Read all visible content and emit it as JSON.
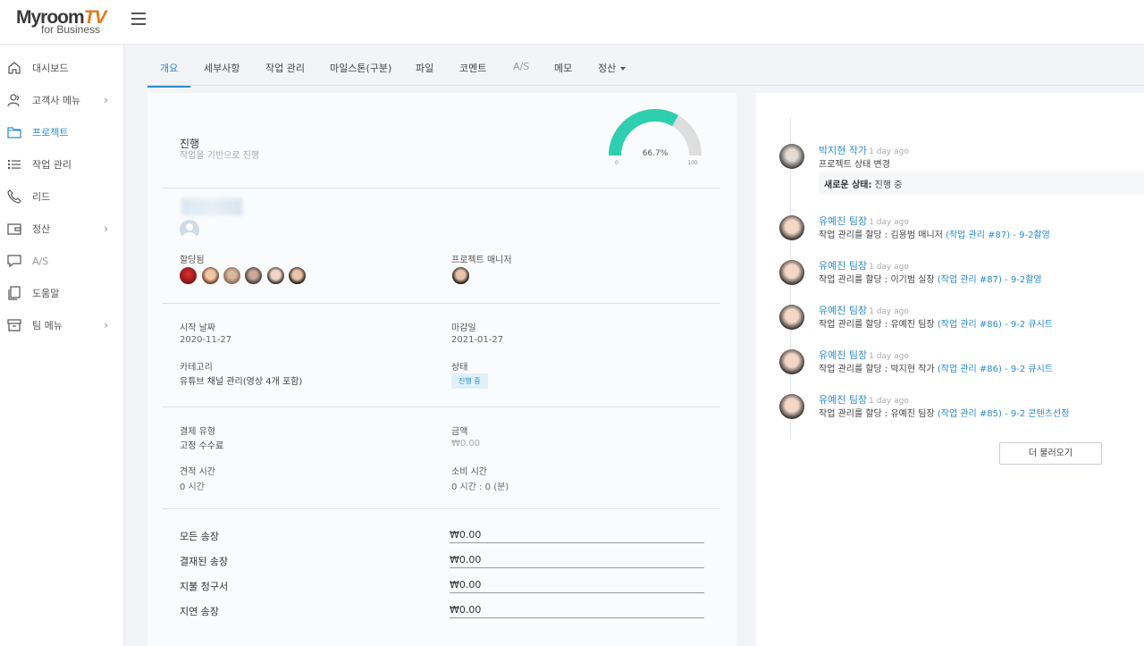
{
  "app": {
    "logo_main": "Myroom",
    "logo_tv": "TV",
    "logo_sub": "for Business"
  },
  "sidebar": {
    "items": [
      {
        "label": "대시보드",
        "icon": "home-icon"
      },
      {
        "label": "고객사 메뉴",
        "icon": "user-group-icon",
        "has_submenu": true
      },
      {
        "label": "프로젝트",
        "icon": "folder-icon",
        "active": true
      },
      {
        "label": "작업 관리",
        "icon": "list-icon"
      },
      {
        "label": "리드",
        "icon": "phone-icon"
      },
      {
        "label": "정산",
        "icon": "wallet-icon",
        "has_submenu": true
      },
      {
        "label": "A/S",
        "icon": "chat-icon"
      },
      {
        "label": "도움말",
        "icon": "document-icon"
      },
      {
        "label": "팀 메뉴",
        "icon": "archive-icon",
        "has_submenu": true
      }
    ]
  },
  "tabs": [
    {
      "label": "개요",
      "active": true
    },
    {
      "label": "세부사항"
    },
    {
      "label": "작업 관리"
    },
    {
      "label": "마일스톤(구분)"
    },
    {
      "label": "파일"
    },
    {
      "label": "코멘트"
    },
    {
      "label": "A/S"
    },
    {
      "label": "메모"
    },
    {
      "label": "정산",
      "dropdown": true
    }
  ],
  "overview": {
    "title": "진행",
    "subtitle": "작업을 기반으로 진행",
    "progress_percent": 66.7,
    "progress_label": "66.7%",
    "gauge_min": "0",
    "gauge_max": "100",
    "assigned_label": "할당됨",
    "manager_label": "프로젝트 매니저",
    "start_date_label": "시작 날짜",
    "start_date": "2020-11-27",
    "deadline_label": "마감일",
    "deadline": "2021-01-27",
    "category_label": "카테고리",
    "category": "유튜브 채널 관리(영상 4개 포함)",
    "status_label": "상태",
    "status": "진행 중",
    "billing_type_label": "결제 유형",
    "billing_type": "고정 수수료",
    "amount_label": "금액",
    "amount": "₩0.00",
    "estimated_time_label": "견적 시간",
    "estimated_time": "0 시간",
    "spent_time_label": "소비 시간",
    "spent_time": "0 시간 : 0 (분)"
  },
  "invoices": [
    {
      "label": "모든 송장",
      "value": "₩0.00"
    },
    {
      "label": "결재된 송장",
      "value": "₩0.00"
    },
    {
      "label": "지불 청구서",
      "value": "₩0.00"
    },
    {
      "label": "지연 송장",
      "value": "₩0.00"
    }
  ],
  "colors": {
    "accent": "#2c8cc9",
    "gauge_fill": "#2ecfb0",
    "gauge_track": "#dedede"
  },
  "feed": {
    "items": [
      {
        "name": "박지현 작가",
        "time": "1 day ago",
        "desc": "프로젝트 상태 변경",
        "status_label": "새로운 상태:",
        "status_value": "진행 중"
      },
      {
        "name": "유예진 팀장",
        "time": "1 day ago",
        "prefix": "작업 관리를 할당 : 김용범 매니저",
        "link": "(작업 관리 #87) - 9-2촬영"
      },
      {
        "name": "유예진 팀장",
        "time": "1 day ago",
        "prefix": "작업 관리를 할당 : 이기범 실장",
        "link": "(작업 관리 #87) - 9-2촬영"
      },
      {
        "name": "유예진 팀장",
        "time": "1 day ago",
        "prefix": "작업 관리를 할당 : 유예진 팀장",
        "link": "(작업 관리 #86) - 9-2 큐시트"
      },
      {
        "name": "유예진 팀장",
        "time": "1 day ago",
        "prefix": "작업 관리를 할당 : 박지현 작가",
        "link": "(작업 관리 #86) - 9-2 큐시트"
      },
      {
        "name": "유예진 팀장",
        "time": "1 day ago",
        "prefix": "작업 관리를 할당 : 유예진 팀장",
        "link": "(작업 관리 #85) - 9-2 콘텐츠선정"
      }
    ],
    "load_more": "더 불러오기"
  }
}
